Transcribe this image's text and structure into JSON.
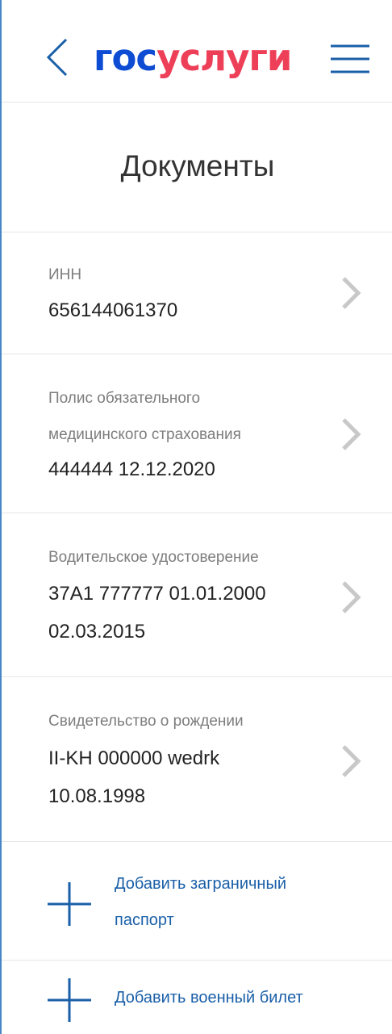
{
  "header": {
    "logo_part1": "гос",
    "logo_part2": "услуги",
    "back_icon": "chevron-left-icon",
    "menu_icon": "hamburger-menu-icon",
    "brand_blue": "#0d4cd3",
    "brand_red": "#ee3f58"
  },
  "page": {
    "title": "Документы"
  },
  "documents": [
    {
      "label_lines": [
        "ИНН"
      ],
      "value_lines": [
        "656144061370"
      ]
    },
    {
      "label_lines": [
        "Полис обязательного",
        "медицинского страхования"
      ],
      "value_lines": [
        "444444 12.12.2020"
      ]
    },
    {
      "label_lines": [
        "Водительское удостоверение"
      ],
      "value_lines": [
        "37A1 777777 01.01.2000",
        "02.03.2015"
      ]
    },
    {
      "label_lines": [
        "Свидетельство о рождении"
      ],
      "value_lines": [
        "II-KH 000000 wedrk",
        "10.08.1998"
      ]
    }
  ],
  "add_actions": [
    {
      "label_lines": [
        "Добавить заграничный",
        "паспорт"
      ],
      "icon": "plus-icon"
    },
    {
      "label_lines": [
        "Добавить военный билет"
      ],
      "icon": "plus-icon"
    }
  ],
  "colors": {
    "link": "#1a5fa8",
    "divider": "#e6e6e6",
    "chevron": "#c8c8c8",
    "frame_border": "#4a86c5"
  }
}
